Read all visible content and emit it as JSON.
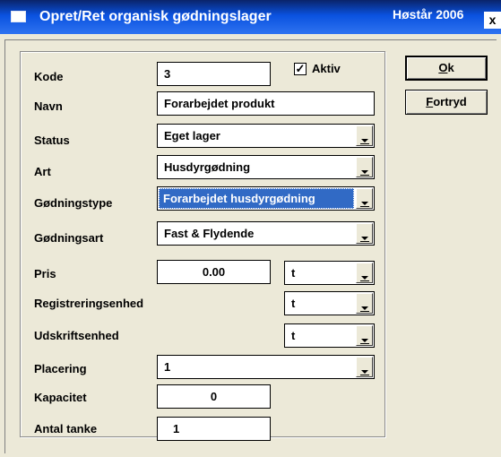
{
  "window": {
    "title": "Opret/Ret organisk gødningslager",
    "season": "Høstår 2006",
    "close_glyph": "x"
  },
  "form": {
    "kode": {
      "label": "Kode",
      "value": "3"
    },
    "aktiv": {
      "label": "Aktiv",
      "checked": true,
      "mark": "✓"
    },
    "navn": {
      "label": "Navn",
      "value": "Forarbejdet produkt"
    },
    "status": {
      "label": "Status",
      "value": "Eget lager"
    },
    "art": {
      "label": "Art",
      "value": "Husdyrgødning"
    },
    "gødningstype": {
      "label": "Gødningstype",
      "value": "Forarbejdet husdyrgødning"
    },
    "gødningsart": {
      "label": "Gødningsart",
      "value": "Fast & Flydende"
    },
    "pris": {
      "label": "Pris",
      "value": "0.00",
      "unit": "t"
    },
    "registreringsenhed": {
      "label": "Registreringsenhed",
      "value": "t"
    },
    "udskriftsenhed": {
      "label": "Udskriftsenhed",
      "value": "t"
    },
    "placering": {
      "label": "Placering",
      "value": "1"
    },
    "kapacitet": {
      "label": "Kapacitet",
      "value": "0"
    },
    "antal_tanke": {
      "label": "Antal tanke",
      "value": "1"
    }
  },
  "buttons": {
    "ok": {
      "label_first": "O",
      "label_rest": "k"
    },
    "fortryd": {
      "label_first": "F",
      "label_rest": "ortryd"
    }
  },
  "colors": {
    "titlebar": "#0A52E0",
    "background": "#ECE9D8",
    "selection": "#316AC5"
  },
  "icons": {
    "window": "window-icon",
    "close": "close-icon",
    "dropdown": "chevron-down-icon"
  }
}
